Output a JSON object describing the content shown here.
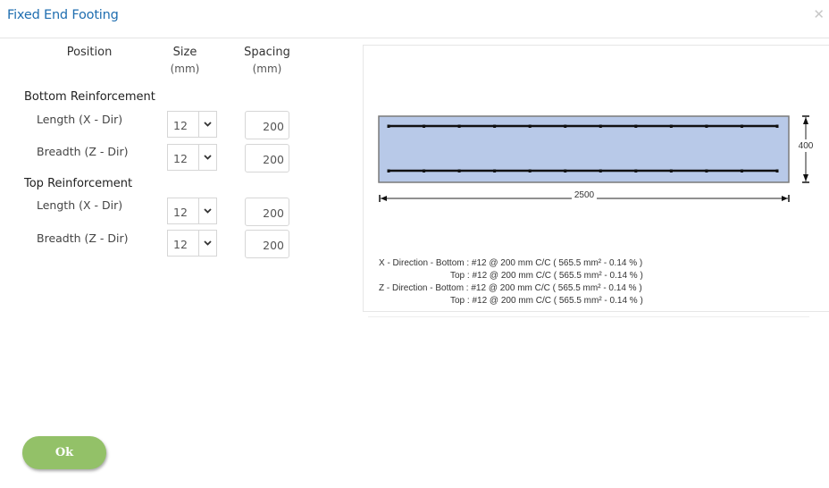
{
  "dialog": {
    "title": "Fixed End Footing",
    "close_icon": "close-icon"
  },
  "columns": {
    "position": "Position",
    "size": "Size",
    "size_unit": "(mm)",
    "spacing": "Spacing",
    "spacing_unit": "(mm)"
  },
  "bottom": {
    "heading": "Bottom Reinforcement",
    "length": {
      "label": "Length (X - Dir)",
      "size": "12",
      "spacing": "200"
    },
    "breadth": {
      "label": "Breadth (Z - Dir)",
      "size": "12",
      "spacing": "200"
    }
  },
  "top": {
    "heading": "Top Reinforcement",
    "length": {
      "label": "Length (X - Dir)",
      "size": "12",
      "spacing": "200"
    },
    "breadth": {
      "label": "Breadth (Z - Dir)",
      "size": "12",
      "spacing": "200"
    }
  },
  "section": {
    "width_label": "2500",
    "depth_label": "400",
    "bar_count": 12,
    "fill_color": "#b8c9e8",
    "outline_color": "#7a7a7a"
  },
  "summary": {
    "line1": "X - Direction - Bottom : #12 @ 200 mm C/C ( 565.5 mm² - 0.14 % )",
    "line2": "Top : #12 @ 200 mm C/C ( 565.5 mm² - 0.14 % )",
    "line3": "Z - Direction - Bottom : #12 @ 200 mm C/C ( 565.5 mm² - 0.14 % )",
    "line4": "Top : #12 @ 200 mm C/C ( 565.5 mm² - 0.14 % )"
  },
  "buttons": {
    "ok": "Ok"
  }
}
